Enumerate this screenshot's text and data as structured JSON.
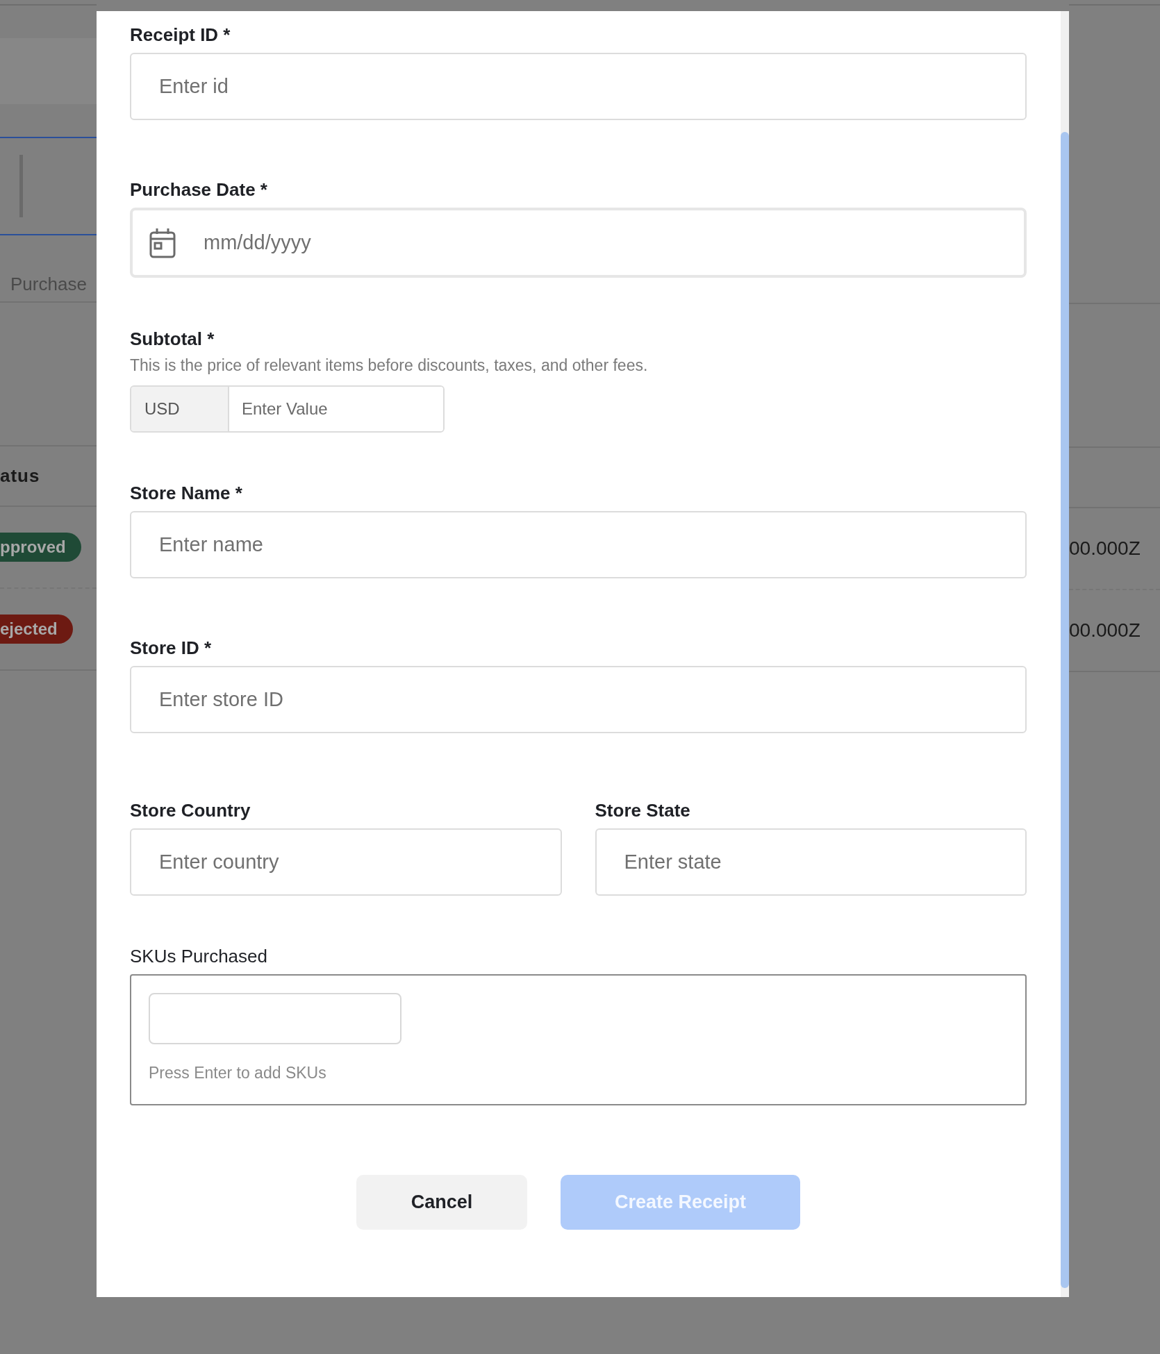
{
  "background": {
    "tab": "Purchase",
    "column_header": "atus",
    "statuses": [
      {
        "label": "pproved",
        "color": "#1f4a36"
      },
      {
        "label": "ejected",
        "color": "#6d1a12"
      }
    ],
    "timestamps": [
      "00.000Z",
      "00.000Z"
    ]
  },
  "form": {
    "fields": [
      {
        "kind": "text",
        "label": "Receipt ID *",
        "placeholder": "Enter id"
      },
      {
        "kind": "date",
        "label": "Purchase Date *",
        "placeholder": "mm/dd/yyyy"
      },
      {
        "kind": "currency",
        "label": "Subtotal *",
        "help": "This is the price of relevant items before discounts, taxes, and other fees.",
        "currency": "USD",
        "placeholder": "Enter Value"
      },
      {
        "kind": "text",
        "label": "Store Name *",
        "placeholder": "Enter name"
      },
      {
        "kind": "text",
        "label": "Store ID *",
        "placeholder": "Enter store ID"
      },
      {
        "kind": "pair",
        "fields": [
          {
            "label": "Store Country",
            "placeholder": "Enter country"
          },
          {
            "label": "Store State",
            "placeholder": "Enter state"
          }
        ]
      },
      {
        "kind": "tags",
        "label": "SKUs Purchased",
        "hint": "Press Enter to add SKUs"
      }
    ],
    "buttons": [
      {
        "kind": "secondary",
        "label": "Cancel",
        "disabled": false
      },
      {
        "kind": "primary",
        "label": "Create Receipt",
        "disabled": true
      }
    ]
  }
}
